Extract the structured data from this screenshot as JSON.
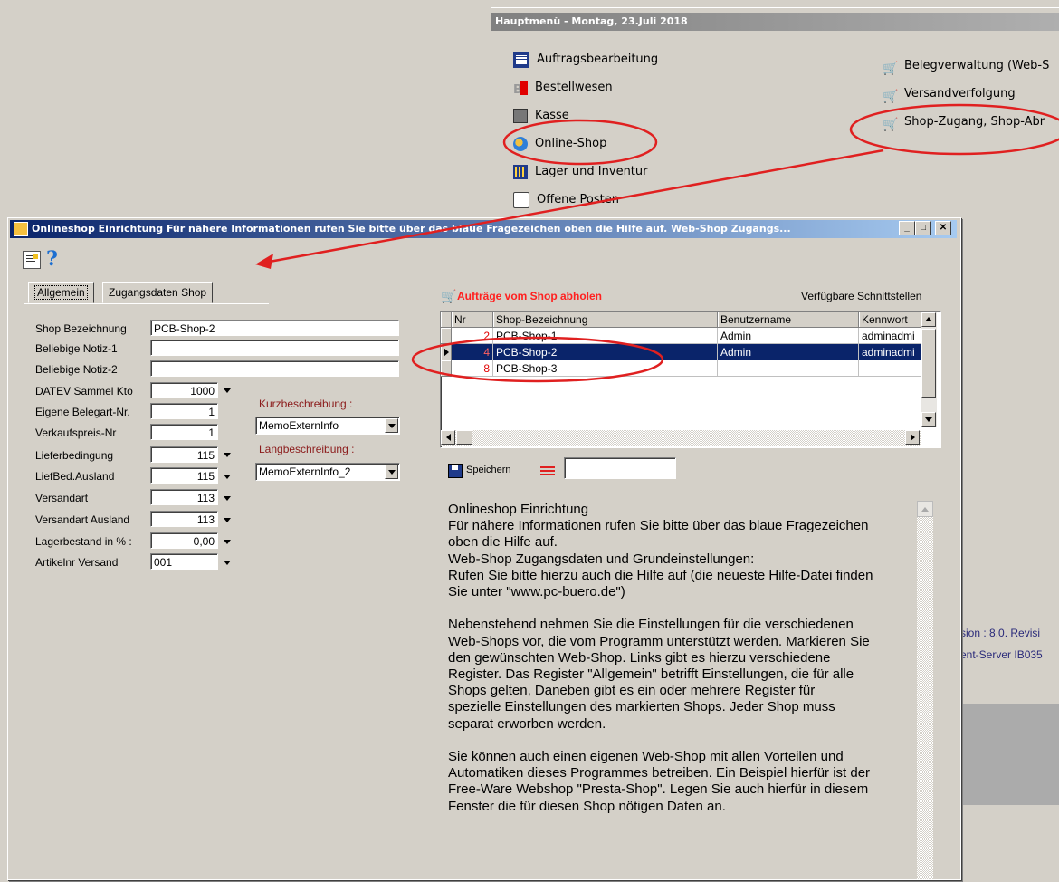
{
  "main_menu": {
    "title": "Hauptmenü - Montag, 23.Juli 2018",
    "left_items": [
      {
        "label": "Auftragsbearbeitung",
        "icon": "table-icon"
      },
      {
        "label": "Bestellwesen",
        "icon": "bestell-icon"
      },
      {
        "label": "Kasse",
        "icon": "register-icon"
      },
      {
        "label": "Online-Shop",
        "icon": "globe-icon"
      },
      {
        "label": "Lager und Inventur",
        "icon": "warehouse-icon"
      },
      {
        "label": "Offene Posten",
        "icon": "ledger-icon"
      }
    ],
    "right_items": [
      {
        "label": "Belegverwaltung (Web-S",
        "icon": "cart-icon"
      },
      {
        "label": "Versandverfolgung",
        "icon": "cart-icon"
      },
      {
        "label": "Shop-Zugang, Shop-Abr",
        "icon": "cart-icon"
      }
    ],
    "version_text": "sion : 8.0. Revisi",
    "server_text": "ent-Server  IB035"
  },
  "dialog": {
    "title": "Onlineshop Einrichtung Für nähere Informationen rufen Sie bitte über das blaue Fragezeichen oben die Hilfe auf. Web-Shop Zugangs...",
    "buttons": {
      "minimize": "_",
      "maximize": "□",
      "close": "✕"
    },
    "tabs": [
      "Allgemein",
      "Zugangsdaten Shop"
    ],
    "form": {
      "shop_bezeichnung": {
        "label": "Shop Bezeichnung",
        "value": "PCB-Shop-2"
      },
      "notiz1": {
        "label": "Beliebige Notiz-1",
        "value": ""
      },
      "notiz2": {
        "label": "Beliebige Notiz-2",
        "value": ""
      },
      "datev": {
        "label": "DATEV Sammel Kto",
        "value": "1000"
      },
      "belegart": {
        "label": "Eigene Belegart-Nr.",
        "value": "1"
      },
      "verkaufspreis": {
        "label": "Verkaufspreis-Nr",
        "value": "1"
      },
      "lieferbedingung": {
        "label": "Lieferbedingung",
        "value": "115"
      },
      "liefbed_ausland": {
        "label": "LiefBed.Ausland",
        "value": "115"
      },
      "versandart": {
        "label": "Versandart",
        "value": "113"
      },
      "versandart_ausland": {
        "label": "Versandart Ausland",
        "value": "113"
      },
      "lagerbestand": {
        "label": "Lagerbestand in % :",
        "value": "0,00"
      },
      "artikelnr_versand": {
        "label": "Artikelnr Versand",
        "value": "001"
      },
      "kurzbeschreibung": {
        "label": "Kurzbeschreibung :",
        "value": "MemoExternInfo"
      },
      "langbeschreibung": {
        "label": "Langbeschreibung :",
        "value": "MemoExternInfo_2"
      }
    },
    "shop_section": {
      "title": "Aufträge vom Shop abholen",
      "interfaces_label": "Verfügbare Schnittstellen",
      "columns": [
        "Nr",
        "Shop-Bezeichnung",
        "Benutzername",
        "Kennwort"
      ],
      "rows": [
        {
          "nr": "2",
          "name": "PCB-Shop-1",
          "user": "Admin",
          "password": "adminadmi"
        },
        {
          "nr": "4",
          "name": "PCB-Shop-2",
          "user": "Admin",
          "password": "adminadmi"
        },
        {
          "nr": "8",
          "name": "PCB-Shop-3",
          "user": "",
          "password": ""
        }
      ],
      "selected_row": 1
    },
    "save_label": "Speichern",
    "save_input": "",
    "help_text": "Onlineshop Einrichtung\nFür nähere Informationen rufen Sie bitte über das blaue Fragezeichen\noben die Hilfe auf.\nWeb-Shop Zugangsdaten und Grundeinstellungen:\nRufen Sie bitte hierzu auch die Hilfe auf (die neueste Hilfe-Datei finden\nSie unter \"www.pc-buero.de\")\n\nNebenstehend nehmen Sie die Einstellungen für die verschiedenen\nWeb-Shops vor, die vom Programm unterstützt werden. Markieren Sie\nden gewünschten Web-Shop. Links gibt es hierzu verschiedene\nRegister. Das Register \"Allgemein\" betrifft Einstellungen, die für alle\nShops gelten, Daneben gibt es ein oder mehrere Register für\nspezielle Einstellungen des markierten Shops. Jeder Shop muss\nseparat erworben werden.\n\nSie können auch einen eigenen Web-Shop mit allen Vorteilen und\nAutomatiken dieses Programmes betreiben. Ein Beispiel hierfür ist der\nFree-Ware Webshop \"Presta-Shop\". Legen Sie auch hierfür in diesem\nFenster die für diesen Shop nötigen Daten an."
  },
  "colors": {
    "annotation": "#e02020",
    "selection": "#0a246a",
    "title_active": "#0a246a",
    "shop_title": "#ff2020"
  }
}
